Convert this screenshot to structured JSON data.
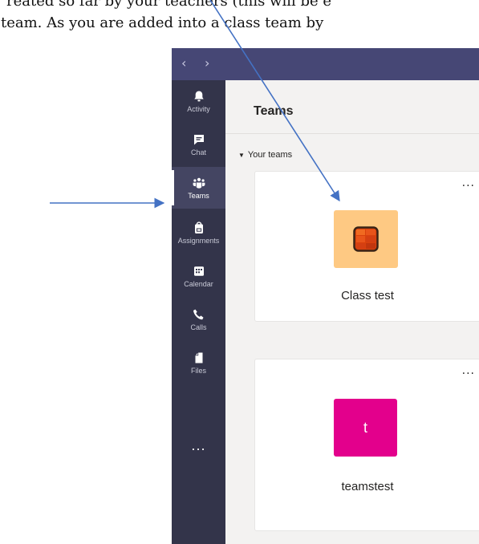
{
  "document": {
    "line1": "reated so far by your teachers (this will be e",
    "line2": "team.  As you are added into a class team by"
  },
  "titlebar": {
    "back_glyph": "‹",
    "forward_glyph": "›"
  },
  "rail": {
    "items": [
      {
        "label": "Activity",
        "icon": "bell-icon"
      },
      {
        "label": "Chat",
        "icon": "chat-icon"
      },
      {
        "label": "Teams",
        "icon": "teams-icon",
        "active": true
      },
      {
        "label": "Assignments",
        "icon": "assignments-icon"
      },
      {
        "label": "Calendar",
        "icon": "calendar-icon"
      },
      {
        "label": "Calls",
        "icon": "phone-icon"
      },
      {
        "label": "Files",
        "icon": "file-icon"
      }
    ],
    "more": "..."
  },
  "header": {
    "title": "Teams"
  },
  "section": {
    "label": "Your teams"
  },
  "teams": [
    {
      "name": "Class test",
      "more": "...",
      "avatar_icon": "class-notebook-icon"
    },
    {
      "name": "teamstest",
      "more": "...",
      "avatar_letter": "t"
    }
  ],
  "colors": {
    "titlebar": "#464775",
    "rail": "#33344a",
    "rail_active": "#444562",
    "annotation_arrow": "#4472c4",
    "class_test_avatar": "#fec983",
    "teamstest_avatar": "#e3008c"
  }
}
